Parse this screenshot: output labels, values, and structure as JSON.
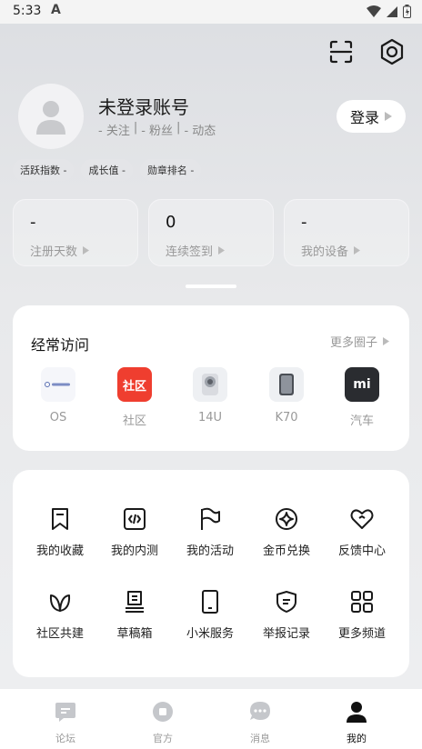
{
  "status_bar": {
    "time": "5:33",
    "a_icon": "A"
  },
  "header": {
    "scan_icon": "scan-icon",
    "settings_icon": "gear-icon"
  },
  "profile": {
    "name": "未登录账号",
    "follow": "- 关注",
    "fans": "- 粉丝",
    "activity": "- 动态",
    "separator": "|",
    "login_label": "登录"
  },
  "tags": [
    "活跃指数 -",
    "成长值 -",
    "勋章排名 -"
  ],
  "stats": [
    {
      "value": "-",
      "label": "注册天数"
    },
    {
      "value": "0",
      "label": "连续签到"
    },
    {
      "value": "-",
      "label": "我的设备"
    }
  ],
  "frequent": {
    "title": "经常访问",
    "more": "更多圈子",
    "items": [
      {
        "label": "OS",
        "icon": "os-icon"
      },
      {
        "label": "社区",
        "icon": "community-icon",
        "icon_text": "社区",
        "color": "#ef3e2f"
      },
      {
        "label": "14U",
        "icon": "phone-14u-icon"
      },
      {
        "label": "K70",
        "icon": "phone-k70-icon"
      },
      {
        "label": "汽车",
        "icon": "car-icon",
        "icon_text": "mi"
      }
    ]
  },
  "grid": [
    {
      "label": "我的收藏",
      "icon": "bookmark-icon"
    },
    {
      "label": "我的内测",
      "icon": "code-icon"
    },
    {
      "label": "我的活动",
      "icon": "flag-icon"
    },
    {
      "label": "金币兑换",
      "icon": "coin-icon"
    },
    {
      "label": "反馈中心",
      "icon": "heart-icon"
    },
    {
      "label": "社区共建",
      "icon": "leaf-icon"
    },
    {
      "label": "草稿箱",
      "icon": "drafts-icon"
    },
    {
      "label": "小米服务",
      "icon": "phone-service-icon"
    },
    {
      "label": "举报记录",
      "icon": "shield-report-icon"
    },
    {
      "label": "更多频道",
      "icon": "grid-icon"
    }
  ],
  "nav": [
    {
      "label": "论坛",
      "icon": "forum-icon",
      "active": false
    },
    {
      "label": "官方",
      "icon": "official-icon",
      "active": false
    },
    {
      "label": "消息",
      "icon": "message-icon",
      "active": false
    },
    {
      "label": "我的",
      "icon": "profile-icon",
      "active": true
    }
  ],
  "colors": {
    "accent_red": "#ef3e2f",
    "text_primary": "#1a1a1a",
    "text_muted": "#999999"
  }
}
